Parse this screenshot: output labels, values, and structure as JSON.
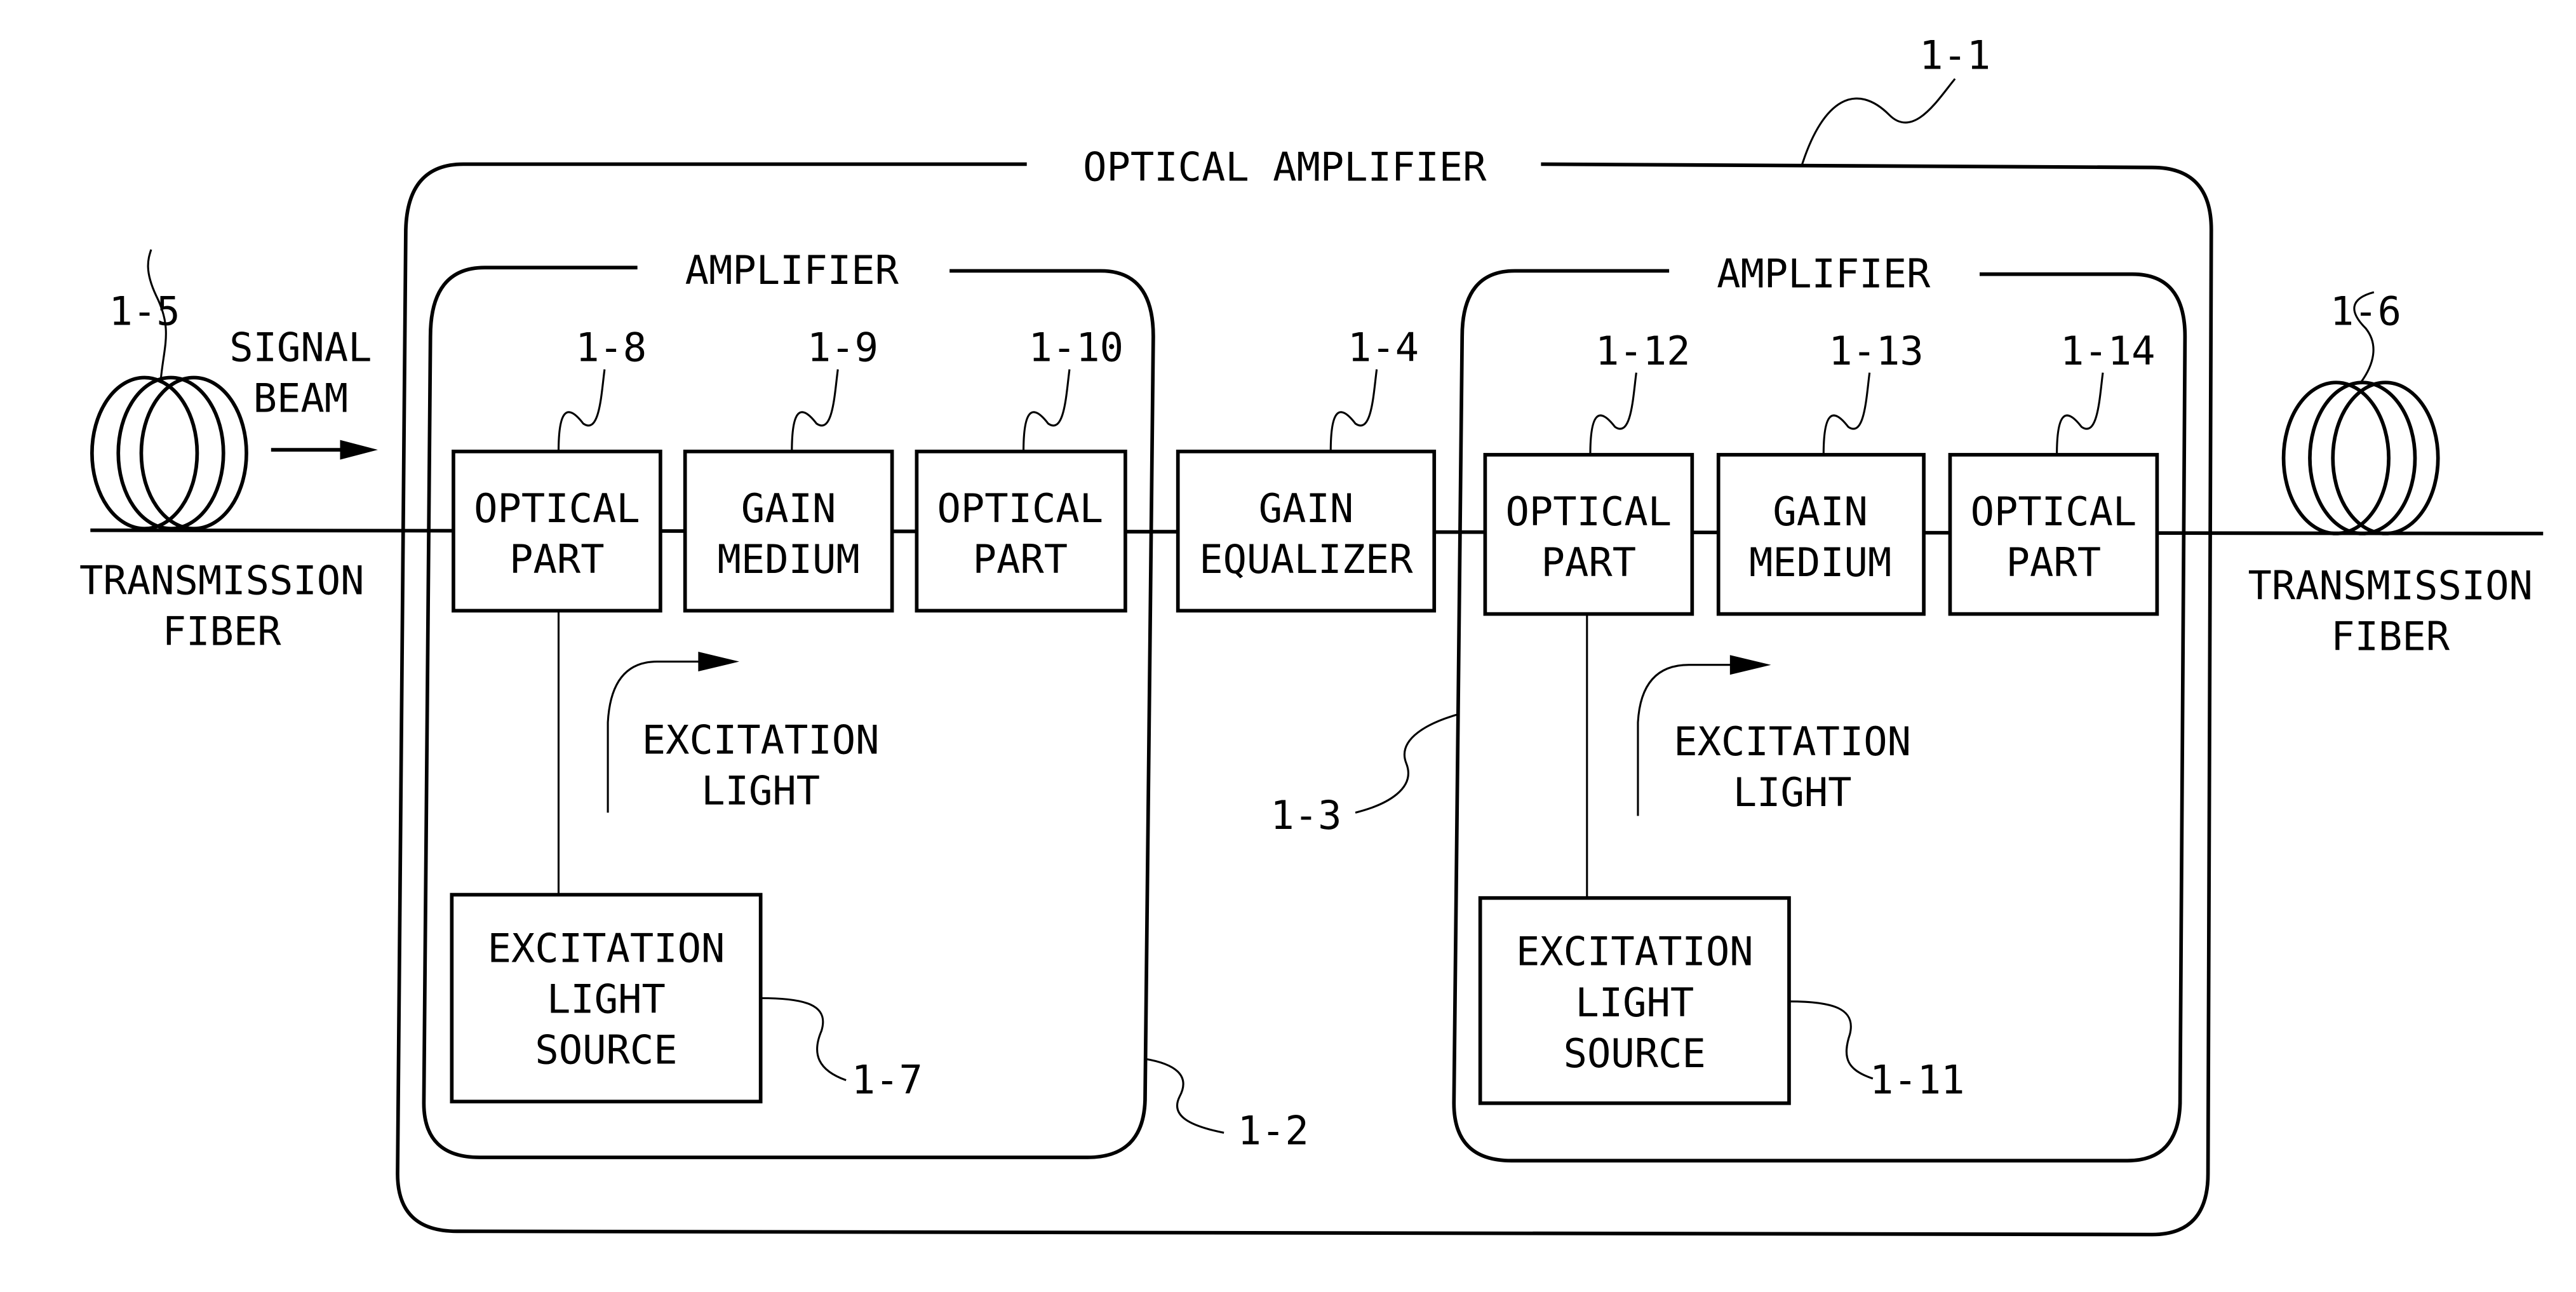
{
  "diagram": {
    "outer": {
      "title": "OPTICAL AMPLIFIER",
      "ref": "1-1"
    },
    "amp_left": {
      "title": "AMPLIFIER",
      "ref": "1-2",
      "blocks": [
        {
          "ref": "1-8",
          "line1": "OPTICAL",
          "line2": "PART"
        },
        {
          "ref": "1-9",
          "line1": "GAIN",
          "line2": "MEDIUM"
        },
        {
          "ref": "1-10",
          "line1": "OPTICAL",
          "line2": "PART"
        }
      ],
      "source": {
        "ref": "1-7",
        "line1": "EXCITATION",
        "line2": "LIGHT",
        "line3": "SOURCE"
      },
      "excitation_label": {
        "line1": "EXCITATION",
        "line2": "LIGHT"
      }
    },
    "equalizer": {
      "ref": "1-4",
      "line1": "GAIN",
      "line2": "EQUALIZER"
    },
    "amp_right": {
      "title": "AMPLIFIER",
      "ref": "1-3",
      "blocks": [
        {
          "ref": "1-12",
          "line1": "OPTICAL",
          "line2": "PART"
        },
        {
          "ref": "1-13",
          "line1": "GAIN",
          "line2": "MEDIUM"
        },
        {
          "ref": "1-14",
          "line1": "OPTICAL",
          "line2": "PART"
        }
      ],
      "source": {
        "ref": "1-11",
        "line1": "EXCITATION",
        "line2": "LIGHT",
        "line3": "SOURCE"
      },
      "excitation_label": {
        "line1": "EXCITATION",
        "line2": "LIGHT"
      }
    },
    "fiber_in": {
      "ref": "1-5",
      "line1": "TRANSMISSION",
      "line2": "FIBER"
    },
    "fiber_out": {
      "ref": "1-6",
      "line1": "TRANSMISSION",
      "line2": "FIBER"
    },
    "signal": {
      "line1": "SIGNAL",
      "line2": "BEAM"
    }
  }
}
